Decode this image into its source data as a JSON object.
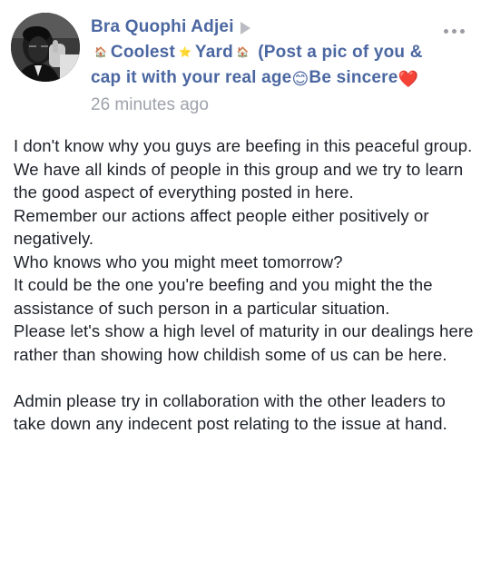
{
  "post": {
    "author": {
      "name": "Bra Quophi Adjei",
      "avatar": "profile-photo"
    },
    "group": {
      "emoji_left": "🏠",
      "name_part1": "Coolest",
      "emoji_mid": "⭐",
      "name_part2": "Yard",
      "emoji_right": "🏠",
      "description_part1": "(Post a pic of you & cap it with your real age",
      "emoji_smile": "😊",
      "description_part2": "Be sincere",
      "emoji_heart": "❤️"
    },
    "timestamp": "26 minutes ago",
    "more_icon": "more-options-icon",
    "body": "I don't know why you guys are beefing in this peaceful group.\nWe have all kinds of people in this group and we try to learn the good aspect of everything posted in here.\nRemember our actions affect people either positively or negatively.\nWho knows who you might meet tomorrow?\nIt could be the one you're beefing and you might the the assistance of such person in a particular situation.\nPlease let's show a high level of maturity in our dealings here rather than showing how childish some of us can be here.\n\nAdmin please try in collaboration with the other leaders to take down any indecent post relating to the issue at hand."
  },
  "colors": {
    "link_blue": "#4b67a1",
    "meta_gray": "#9ea2ab",
    "text": "#1d2129",
    "background": "#ffffff"
  }
}
